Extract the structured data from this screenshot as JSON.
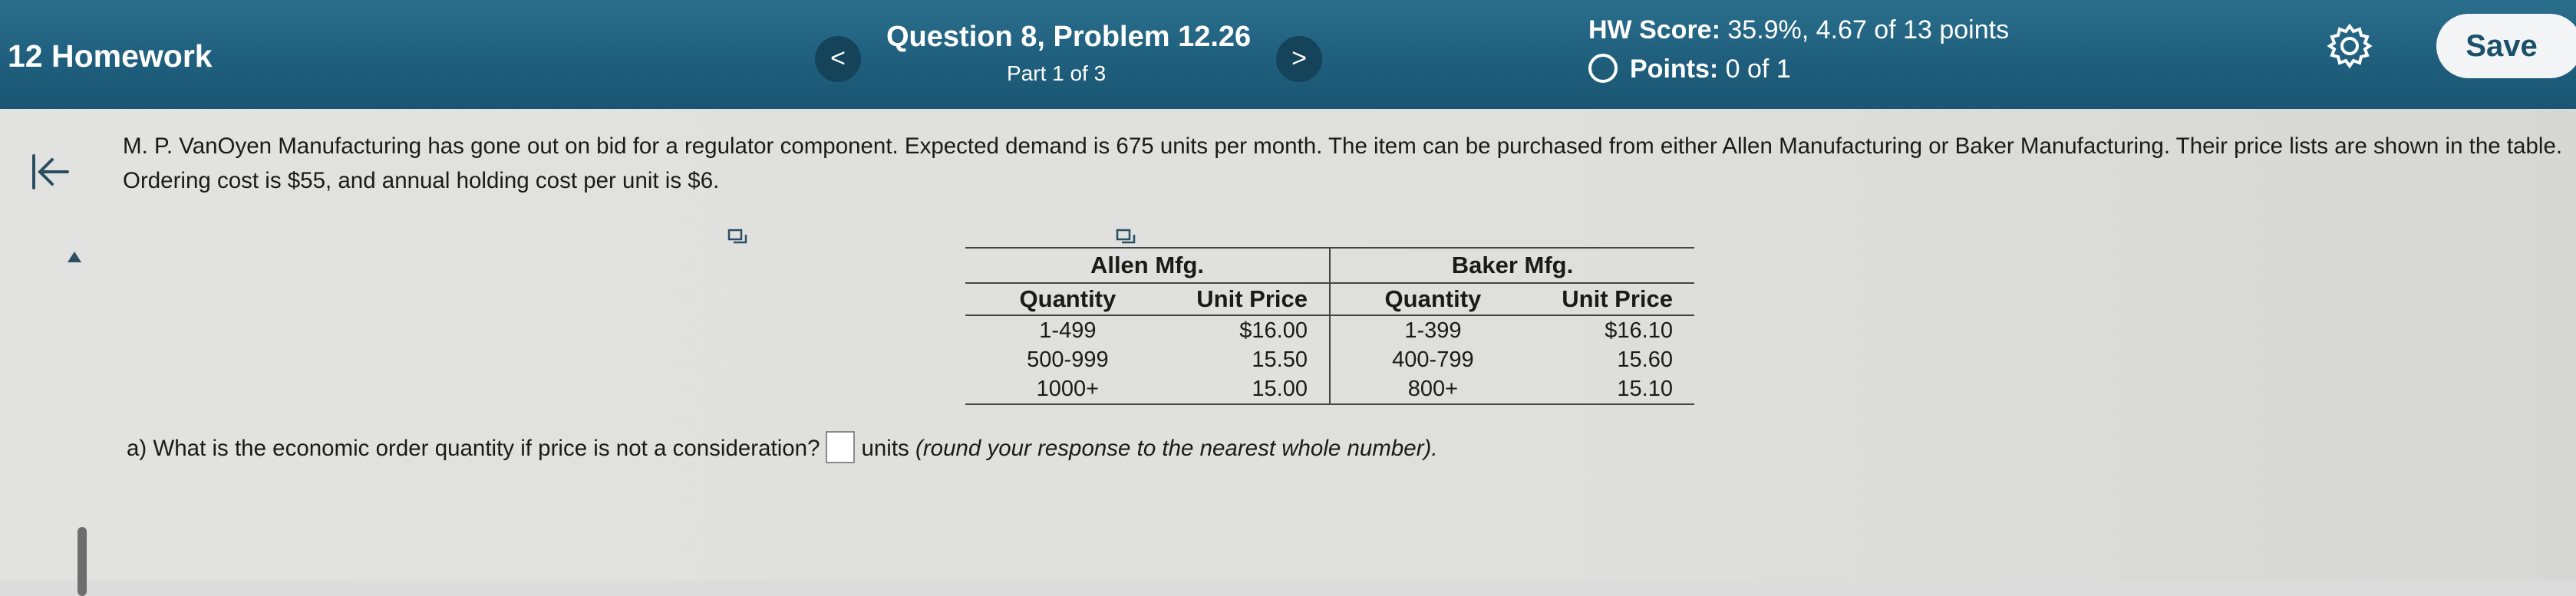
{
  "header": {
    "homework_title": "12 Homework",
    "prev_label": "<",
    "next_label": ">",
    "question_title": "Question 8, Problem 12.26",
    "question_part": "Part 1 of 3",
    "hw_score_label": "HW Score:",
    "hw_score_value": "35.9%, 4.67 of 13 points",
    "points_label": "Points:",
    "points_value": "0 of 1",
    "save_label": "Save"
  },
  "problem": {
    "text": "M. P. VanOyen Manufacturing has gone out on bid for a regulator component. Expected demand is 675 units per month. The item can be purchased from either Allen Manufacturing or Baker Manufacturing. Their price lists are shown in the table. Ordering cost is $55, and annual holding cost per unit is $6."
  },
  "table": {
    "groups": [
      "Allen Mfg.",
      "Baker Mfg."
    ],
    "columns": [
      "Quantity",
      "Unit Price",
      "Quantity",
      "Unit Price"
    ],
    "rows": [
      [
        "1-499",
        "$16.00",
        "1-399",
        "$16.10"
      ],
      [
        "500-999",
        "15.50",
        "400-799",
        "15.60"
      ],
      [
        "1000+",
        "15.00",
        "800+",
        "15.10"
      ]
    ]
  },
  "question": {
    "prefix": "a) What is the economic order quantity if price is not a consideration?",
    "answer_value": "",
    "suffix_units": "units",
    "suffix_note": "(round your response to the nearest whole number)."
  },
  "colors": {
    "header_bg": "#1f5f7d",
    "nav_button_bg": "#14435a",
    "save_button_bg": "#f2f4f5",
    "save_text": "#1b4f6a",
    "content_bg": "#e0e0de"
  },
  "icons": [
    "gear-icon",
    "collapse-icon",
    "copy-icon",
    "up-arrow-icon",
    "radio-circle-icon"
  ]
}
